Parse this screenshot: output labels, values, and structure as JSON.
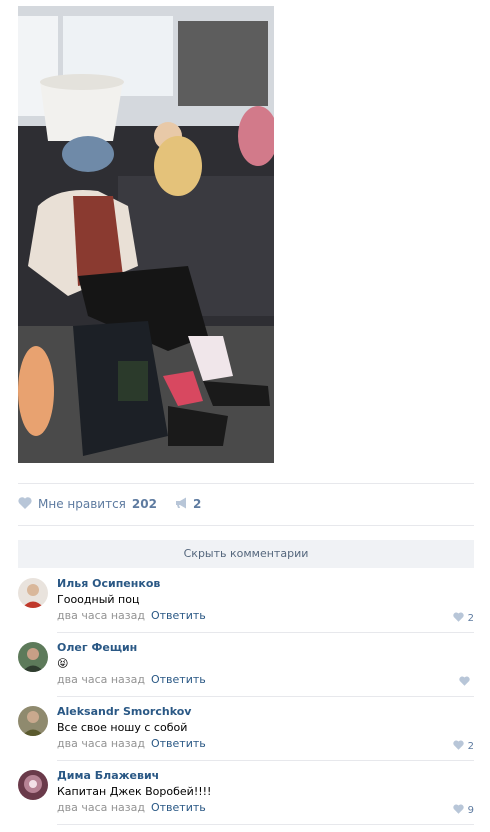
{
  "post": {
    "photo_icon": "post-photo",
    "likes_label": "Мне нравится",
    "likes_count": "202",
    "shares_count": "2"
  },
  "comments_toggle_label": "Скрыть комментарии",
  "comments": [
    {
      "author": "Илья Осипенков",
      "text": "Гооодный поц",
      "time": "два часа назад",
      "reply": "Ответить",
      "likes": "2",
      "avatar_color": "#c0392b"
    },
    {
      "author": "Олег Фещин",
      "text": "😝",
      "time": "два часа назад",
      "reply": "Ответить",
      "likes": "",
      "avatar_color": "#4a6a4a"
    },
    {
      "author": "Aleksandr Smorchkov",
      "text": "Все свое ношу с собой",
      "time": "два часа назад",
      "reply": "Ответить",
      "likes": "2",
      "avatar_color": "#7a6b3a"
    },
    {
      "author": "Дима Блажевич",
      "text": "Капитан Джек Воробей!!!!",
      "time": "два часа назад",
      "reply": "Ответить",
      "likes": "9",
      "avatar_color": "#8a3c52"
    }
  ],
  "colors": {
    "link": "#2a5885",
    "meta": "#939393",
    "accent": "#5e7ba0"
  }
}
